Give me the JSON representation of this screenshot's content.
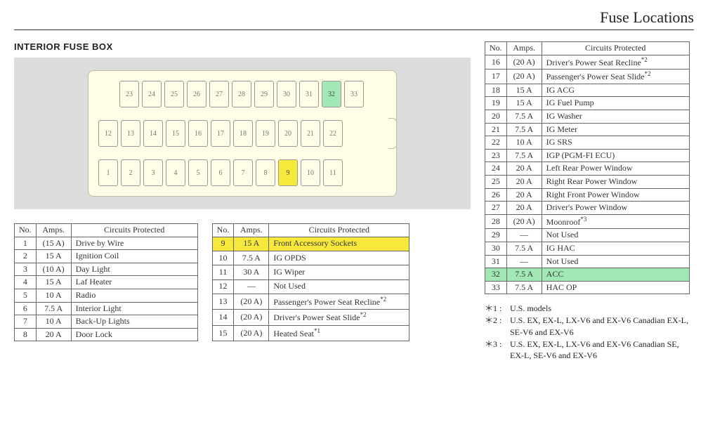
{
  "page_title": "Fuse Locations",
  "section_title": "INTERIOR FUSE BOX",
  "fusebox_rows": [
    {
      "offset": true,
      "slots": [
        {
          "n": "23"
        },
        {
          "n": "24"
        },
        {
          "n": "25"
        },
        {
          "n": "26"
        },
        {
          "n": "27"
        },
        {
          "n": "28"
        },
        {
          "n": "29"
        },
        {
          "n": "30"
        },
        {
          "n": "31"
        },
        {
          "n": "32",
          "hl": "green"
        },
        {
          "n": "33"
        }
      ]
    },
    {
      "offset": false,
      "slots": [
        {
          "n": "12"
        },
        {
          "n": "13"
        },
        {
          "n": "14"
        },
        {
          "n": "15"
        },
        {
          "n": "16"
        },
        {
          "n": "17"
        },
        {
          "n": "18"
        },
        {
          "n": "19"
        },
        {
          "n": "20"
        },
        {
          "n": "21"
        },
        {
          "n": "22"
        }
      ]
    },
    {
      "offset": false,
      "slots": [
        {
          "n": "1"
        },
        {
          "n": "2"
        },
        {
          "n": "3"
        },
        {
          "n": "4"
        },
        {
          "n": "5"
        },
        {
          "n": "6"
        },
        {
          "n": "7"
        },
        {
          "n": "8"
        },
        {
          "n": "9",
          "hl": "yellow"
        },
        {
          "n": "10"
        },
        {
          "n": "11"
        }
      ]
    }
  ],
  "table_headers": {
    "no": "No.",
    "amps": "Amps.",
    "circuits": "Circuits Protected"
  },
  "table1": [
    {
      "no": "1",
      "amps": "(15 A)",
      "circuit": "Drive by Wire"
    },
    {
      "no": "2",
      "amps": "15 A",
      "circuit": "Ignition  Coil"
    },
    {
      "no": "3",
      "amps": "(10 A)",
      "circuit": "Day Light"
    },
    {
      "no": "4",
      "amps": "15 A",
      "circuit": "Laf Heater"
    },
    {
      "no": "5",
      "amps": "10 A",
      "circuit": "Radio"
    },
    {
      "no": "6",
      "amps": "7.5 A",
      "circuit": "Interior Light"
    },
    {
      "no": "7",
      "amps": "10 A",
      "circuit": "Back-Up Lights"
    },
    {
      "no": "8",
      "amps": "20 A",
      "circuit": "Door Lock"
    }
  ],
  "table2": [
    {
      "no": "9",
      "amps": "15 A",
      "circuit": "Front Accessory Sockets",
      "hl": "yellow"
    },
    {
      "no": "10",
      "amps": "7.5 A",
      "circuit": "IG OPDS"
    },
    {
      "no": "11",
      "amps": "30 A",
      "circuit": "IG Wiper"
    },
    {
      "no": "12",
      "amps": "—",
      "circuit": "Not Used"
    },
    {
      "no": "13",
      "amps": "(20 A)",
      "circuit": "Passenger's Power Seat Recline",
      "sup": "*2"
    },
    {
      "no": "14",
      "amps": "(20 A)",
      "circuit": "Driver's Power Seat Slide",
      "sup": "*2"
    },
    {
      "no": "15",
      "amps": "(20 A)",
      "circuit": "Heated Seat",
      "sup": "*1"
    }
  ],
  "table3": [
    {
      "no": "16",
      "amps": "(20 A)",
      "circuit": "Driver's Power Seat Recline",
      "sup": "*2"
    },
    {
      "no": "17",
      "amps": "(20 A)",
      "circuit": "Passenger's Power Seat Slide",
      "sup": "*2"
    },
    {
      "no": "18",
      "amps": "15 A",
      "circuit": "IG ACG"
    },
    {
      "no": "19",
      "amps": "15 A",
      "circuit": "IG Fuel Pump"
    },
    {
      "no": "20",
      "amps": "7.5 A",
      "circuit": "IG Washer"
    },
    {
      "no": "21",
      "amps": "7.5 A",
      "circuit": "IG Meter"
    },
    {
      "no": "22",
      "amps": "10 A",
      "circuit": "IG SRS"
    },
    {
      "no": "23",
      "amps": "7.5 A",
      "circuit": "IGP (PGM-FI ECU)"
    },
    {
      "no": "24",
      "amps": "20 A",
      "circuit": "Left Rear Power Window"
    },
    {
      "no": "25",
      "amps": "20 A",
      "circuit": "Right Rear Power Window"
    },
    {
      "no": "26",
      "amps": "20 A",
      "circuit": "Right Front Power Window"
    },
    {
      "no": "27",
      "amps": "20 A",
      "circuit": "Driver's Power Window"
    },
    {
      "no": "28",
      "amps": "(20 A)",
      "circuit": "Moonroof",
      "sup": "*3"
    },
    {
      "no": "29",
      "amps": "—",
      "circuit": "Not Used"
    },
    {
      "no": "30",
      "amps": "7.5 A",
      "circuit": "IG HAC"
    },
    {
      "no": "31",
      "amps": "—",
      "circuit": "Not Used"
    },
    {
      "no": "32",
      "amps": "7.5 A",
      "circuit": "ACC",
      "hl": "green"
    },
    {
      "no": "33",
      "amps": "7.5 A",
      "circuit": "HAC OP"
    }
  ],
  "footnotes": [
    {
      "label": "＊1 :",
      "text": "U.S. models"
    },
    {
      "label": "＊2 :",
      "text": "U.S. EX, EX-L, LX-V6 and EX-V6 Canadian EX-L, SE-V6 and EX-V6"
    },
    {
      "label": "＊3 :",
      "text": "U.S. EX, EX-L, LX-V6 and EX-V6 Canadian SE, EX-L, SE-V6 and EX-V6"
    }
  ]
}
